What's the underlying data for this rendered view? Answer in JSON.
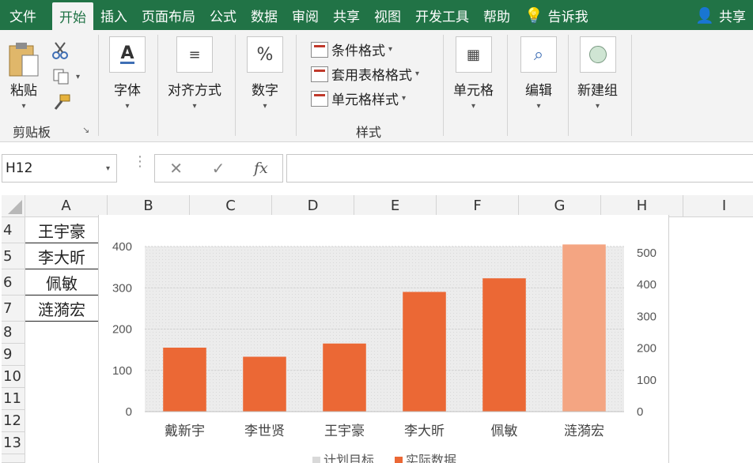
{
  "ribbon_tabs": [
    "文件",
    "开始",
    "插入",
    "页面布局",
    "公式",
    "数据",
    "审阅",
    "共享",
    "视图",
    "开发工具",
    "帮助"
  ],
  "tell_me": "告诉我",
  "share": "共享",
  "clipboard": {
    "paste": "粘贴",
    "group_label": "剪贴板"
  },
  "font": {
    "label": "字体"
  },
  "alignment": {
    "label": "对齐方式"
  },
  "number": {
    "label": "数字"
  },
  "styles": {
    "conditional": "条件格式",
    "table_format": "套用表格格式",
    "cell_styles": "单元格样式",
    "group_label": "样式"
  },
  "cells": {
    "label": "单元格"
  },
  "editing": {
    "label": "编辑"
  },
  "new_group": {
    "label": "新建组"
  },
  "formula_bar": {
    "name_box": "H12",
    "formula": "",
    "fx": "fx"
  },
  "columns": [
    "A",
    "B",
    "C",
    "D",
    "E",
    "F",
    "G",
    "H",
    "I"
  ],
  "rows": [
    "4",
    "5",
    "6",
    "7",
    "8",
    "9",
    "10",
    "11",
    "12",
    "13"
  ],
  "cells_a": [
    "王宇豪",
    "李大昕",
    "佩敏",
    "涟漪宏"
  ],
  "colors": {
    "accent": "#217346",
    "bar": "#EB6835",
    "bar_highlight": "#F4A582"
  },
  "chart_data": {
    "type": "bar",
    "categories": [
      "戴新宇",
      "李世贤",
      "王宇豪",
      "李大昕",
      "佩敏",
      "涟漪宏"
    ],
    "series": [
      {
        "name": "计划目标",
        "values": [
          150,
          130,
          160,
          285,
          315,
          395
        ]
      },
      {
        "name": "实际数据",
        "values": [
          155,
          133,
          165,
          290,
          323,
          405
        ]
      }
    ],
    "left_ticks": [
      "0",
      "100",
      "200",
      "300",
      "400"
    ],
    "right_ticks": [
      "0",
      "100",
      "200",
      "300",
      "400",
      "500"
    ],
    "ylim_left": [
      0,
      400
    ],
    "ylim_right": [
      0,
      500
    ],
    "legend_position": "bottom",
    "highlight_category": "涟漪宏",
    "grid": true
  }
}
